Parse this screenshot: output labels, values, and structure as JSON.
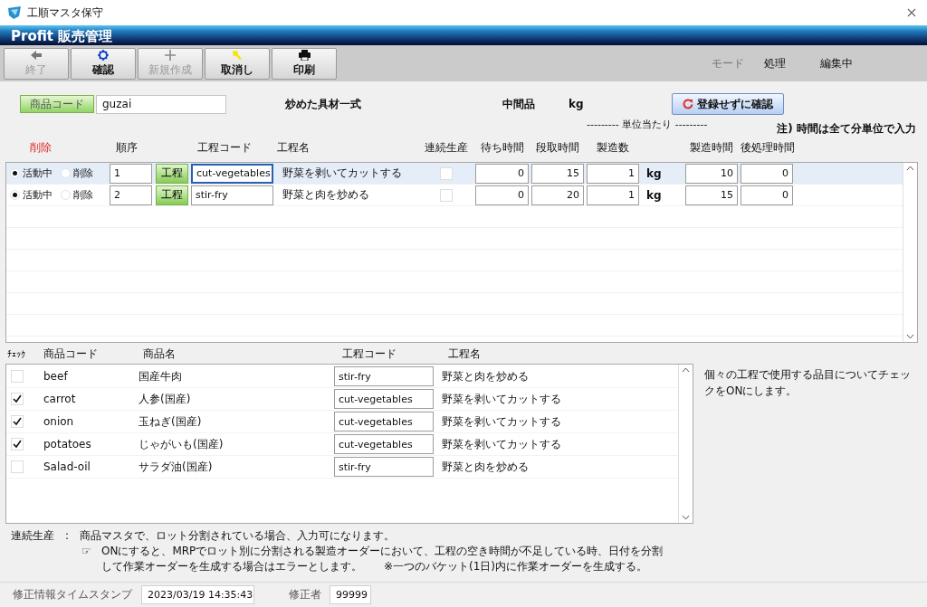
{
  "window": {
    "title": "工順マスタ保守"
  },
  "app_header": {
    "title": "Profit 販売管理"
  },
  "toolbar": {
    "buttons": [
      {
        "kind": "back",
        "label": "終了",
        "disabled": true
      },
      {
        "kind": "confirm",
        "label": "確認",
        "disabled": false
      },
      {
        "kind": "new",
        "label": "新規作成",
        "disabled": true
      },
      {
        "kind": "cancel",
        "label": "取消し",
        "disabled": false
      },
      {
        "kind": "print",
        "label": "印刷",
        "disabled": false
      }
    ],
    "mode_label": "モード",
    "mode_values": [
      "処理",
      "編集中"
    ]
  },
  "product": {
    "code_label": "商品コード",
    "code": "guzai",
    "name": "炒めた具材一式",
    "type": "中間品",
    "unit": "kg",
    "confirm_button": "登録せずに確認"
  },
  "per_unit_caption": "--------- 単位当たり ---------",
  "note": "注) 時間は全て分単位で入力",
  "process_table": {
    "columns": [
      "削除",
      "順序",
      "",
      "工程コード",
      "工程名",
      "連続生産",
      "待ち時間",
      "段取時間",
      "製造数",
      "",
      "製造時間",
      "後処理時間"
    ],
    "rows": [
      {
        "selected": true,
        "active_label": "活動中",
        "delete_label": "削除",
        "active": true,
        "seq": "1",
        "process_button": "工程",
        "code": "cut-vegetables",
        "name": "野菜を剥いてカットする",
        "continuous": false,
        "wait": "0",
        "setup": "15",
        "qty": "1",
        "unit": "kg",
        "mfg_time": "10",
        "post_time": "0"
      },
      {
        "selected": false,
        "active_label": "活動中",
        "delete_label": "削除",
        "active": true,
        "seq": "2",
        "process_button": "工程",
        "code": "stir-fry",
        "name": "野菜と肉を炒める",
        "continuous": false,
        "wait": "0",
        "setup": "20",
        "qty": "1",
        "unit": "kg",
        "mfg_time": "15",
        "post_time": "0"
      }
    ]
  },
  "items_table": {
    "columns": [
      "ﾁｪｯｸ",
      "商品コード",
      "商品名",
      "工程コード",
      "工程名"
    ],
    "rows": [
      {
        "checked": false,
        "code": "beef",
        "name": "国産牛肉",
        "process_code": "stir-fry",
        "process_name": "野菜と肉を炒める"
      },
      {
        "checked": true,
        "code": "carrot",
        "name": "人参(国産)",
        "process_code": "cut-vegetables",
        "process_name": "野菜を剥いてカットする"
      },
      {
        "checked": true,
        "code": "onion",
        "name": "玉ねぎ(国産)",
        "process_code": "cut-vegetables",
        "process_name": "野菜を剥いてカットする"
      },
      {
        "checked": true,
        "code": "potatoes",
        "name": "じゃがいも(国産)",
        "process_code": "cut-vegetables",
        "process_name": "野菜を剥いてカットする"
      },
      {
        "checked": false,
        "code": "Salad-oil",
        "name": "サラダ油(国産)",
        "process_code": "stir-fry",
        "process_name": "野菜と肉を炒める"
      }
    ]
  },
  "items_hint": "個々の工程で使用する品目についてチェックをONにします。",
  "footnote": {
    "label": "連続生産",
    "separator": ":",
    "line1": "商品マスタで、ロット分割されている場合、入力可になります。",
    "pointer": "☞",
    "line2": "ONにすると、MRPでロット別に分割される製造オーダーにおいて、工程の空き時間が不足している時、日付を分割",
    "line2_cont": "して作業オーダーを生成する場合はエラーとします。",
    "line3": "※一つのバケット(1日)内に作業オーダーを生成する。"
  },
  "status_bar": {
    "timestamp_label": "修正情報タイムスタンプ",
    "timestamp": "2023/03/19 14:35:43",
    "editor_label": "修正者",
    "editor": "99999"
  }
}
